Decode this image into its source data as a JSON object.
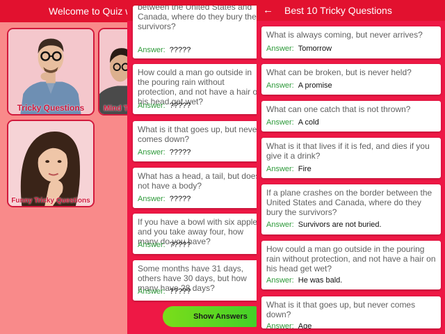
{
  "screen1": {
    "title": "Welcome to Quiz w",
    "tiles": [
      {
        "label": "Tricky Questions"
      },
      {
        "label": "Mind T"
      },
      {
        "label": "Funny Tricky Questions"
      }
    ]
  },
  "screen2": {
    "title": "Best 10 Tricky Questions",
    "back_icon": "←",
    "answer_label": "Answer:",
    "cards": [
      {
        "question": "If a plane crashes on the border between the United States and Canada, where do they bury the survivors?",
        "answer": "?????"
      },
      {
        "question": "How could a man go outside in the pouring rain without protection, and not have a hair on his head get wet?",
        "answer": "?????"
      },
      {
        "question": "What is it that goes up, but never comes down?",
        "answer": "?????"
      },
      {
        "question": "What has a head, a tail, but does not have a body?",
        "answer": "?????"
      },
      {
        "question": "If you have a bowl with six apples and you take away four, how many do you have?",
        "answer": "?????"
      },
      {
        "question": "Some months have 31 days, others have 30 days, but how many have 28 days?",
        "answer": "?????"
      }
    ],
    "show_answers": "Show Answers"
  },
  "screen3": {
    "title": "Best 10 Tricky Questions",
    "back_icon": "←",
    "answer_label": "Answer:",
    "cards": [
      {
        "question": "What is always coming, but never arrives?",
        "answer": "Tomorrow"
      },
      {
        "question": "What can be broken, but is never held?",
        "answer": "A promise"
      },
      {
        "question": "What can one catch that is not thrown?",
        "answer": "A cold"
      },
      {
        "question": "What is it that lives if it is fed, and dies if you give it a drink?",
        "answer": "Fire"
      },
      {
        "question": "If a plane crashes on the border between the United States and Canada, where do they bury the survivors?",
        "answer": "Survivors are not buried."
      },
      {
        "question": "How could a man go outside in the pouring rain without protection, and not have a hair on his head get wet?",
        "answer": "He was bald."
      },
      {
        "question": "What is it that goes up, but never comes down?",
        "answer": "Age"
      }
    ]
  },
  "colors": {
    "app_bar": "#e2112f",
    "background": "#ee1845",
    "answer_label": "#2e9a3a",
    "menu_background": "#f98a8a",
    "button_green": "#5bd625"
  }
}
